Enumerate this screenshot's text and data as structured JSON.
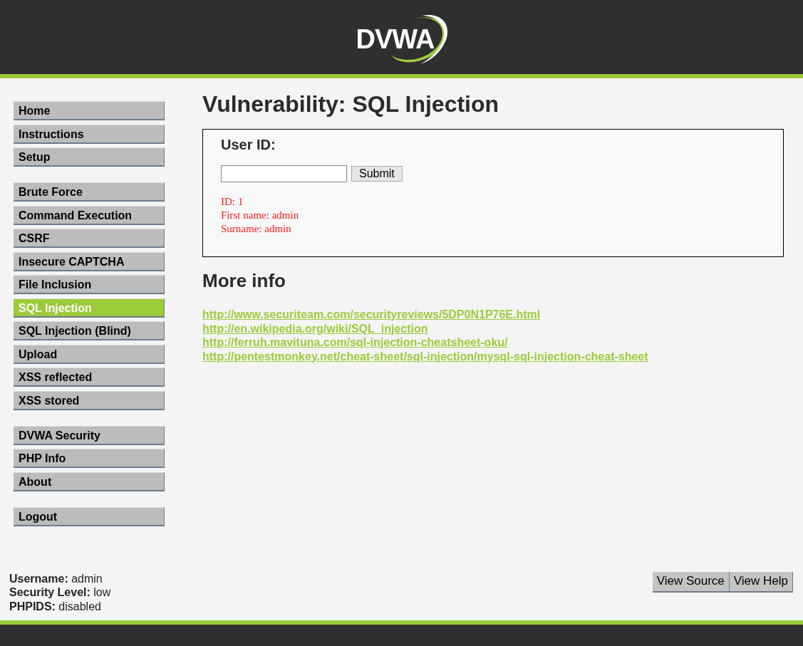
{
  "header": {
    "logo_text": "DVWA"
  },
  "menu_groups": [
    {
      "items": [
        {
          "label": "Home",
          "selected": false
        },
        {
          "label": "Instructions",
          "selected": false
        },
        {
          "label": "Setup",
          "selected": false
        }
      ]
    },
    {
      "items": [
        {
          "label": "Brute Force",
          "selected": false
        },
        {
          "label": "Command Execution",
          "selected": false
        },
        {
          "label": "CSRF",
          "selected": false
        },
        {
          "label": "Insecure CAPTCHA",
          "selected": false
        },
        {
          "label": "File Inclusion",
          "selected": false
        },
        {
          "label": "SQL Injection",
          "selected": true
        },
        {
          "label": "SQL Injection (Blind)",
          "selected": false
        },
        {
          "label": "Upload",
          "selected": false
        },
        {
          "label": "XSS reflected",
          "selected": false
        },
        {
          "label": "XSS stored",
          "selected": false
        }
      ]
    },
    {
      "items": [
        {
          "label": "DVWA Security",
          "selected": false
        },
        {
          "label": "PHP Info",
          "selected": false
        },
        {
          "label": "About",
          "selected": false
        }
      ]
    },
    {
      "items": [
        {
          "label": "Logout",
          "selected": false
        }
      ]
    }
  ],
  "main": {
    "title": "Vulnerability: SQL Injection",
    "form": {
      "label": "User ID:",
      "button": "Submit",
      "output": [
        "ID: 1",
        "First name: admin",
        "Surname: admin"
      ]
    },
    "more_info_title": "More info",
    "links": [
      "http://www.securiteam.com/securityreviews/5DP0N1P76E.html",
      "http://en.wikipedia.org/wiki/SQL_injection",
      "http://ferruh.mavituna.com/sql-injection-cheatsheet-oku/",
      "http://pentestmonkey.net/cheat-sheet/sql-injection/mysql-sql-injection-cheat-sheet"
    ]
  },
  "status": [
    {
      "label": "Username:",
      "value": "admin"
    },
    {
      "label": "Security Level:",
      "value": "low"
    },
    {
      "label": "PHPIDS:",
      "value": "disabled"
    }
  ],
  "footer_buttons": [
    "View Source",
    "View Help"
  ]
}
